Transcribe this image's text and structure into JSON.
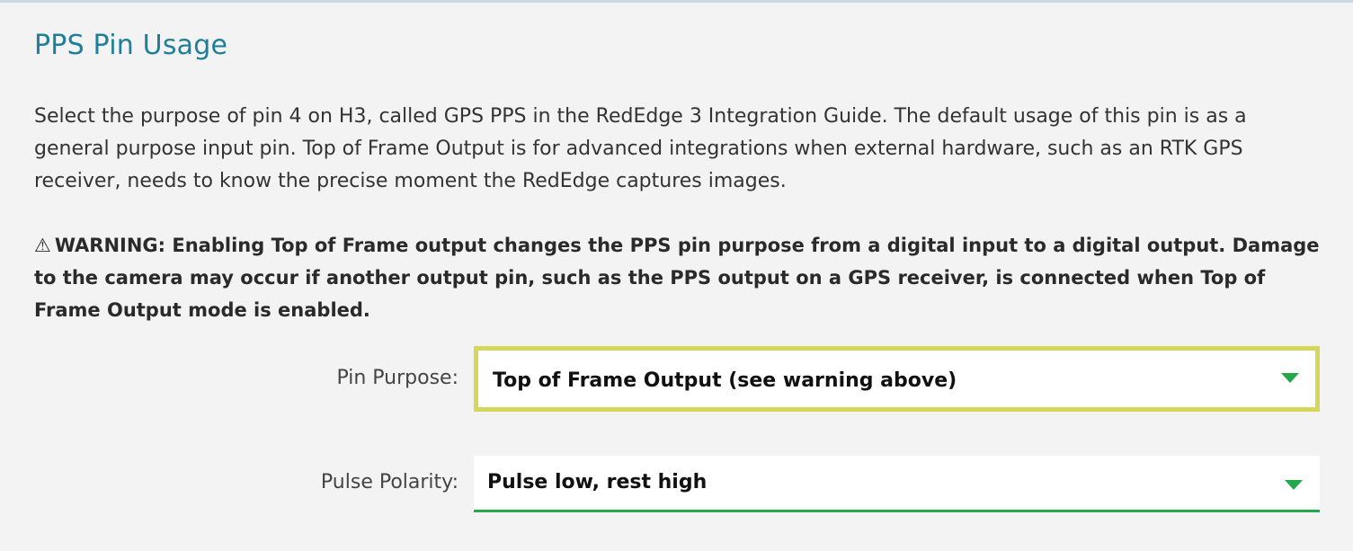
{
  "section": {
    "title": "PPS Pin Usage",
    "description": "Select the purpose of pin 4 on H3, called GPS PPS in the RedEdge 3 Integration Guide. The default usage of this pin is as a general purpose input pin. Top of Frame Output is for advanced integrations when external hardware, such as an RTK GPS receiver, needs to know the precise moment the RedEdge captures images.",
    "warning_icon": "⚠",
    "warning": "WARNING: Enabling Top of Frame output changes the PPS pin purpose from a digital input to a digital output. Damage to the camera may occur if another output pin, such as the PPS output on a GPS receiver, is connected when Top of Frame Output mode is enabled."
  },
  "form": {
    "pin_purpose": {
      "label": "Pin Purpose:",
      "value": "Top of Frame Output (see warning above)",
      "icon": "chevron-down-icon"
    },
    "pulse_polarity": {
      "label": "Pulse Polarity:",
      "value": "Pulse low, rest high",
      "icon": "chevron-down-icon"
    }
  },
  "colors": {
    "title": "#1f7f9a",
    "focus_border": "#d6d65a",
    "accent_green": "#25a84a",
    "background": "#f3f3f3"
  }
}
